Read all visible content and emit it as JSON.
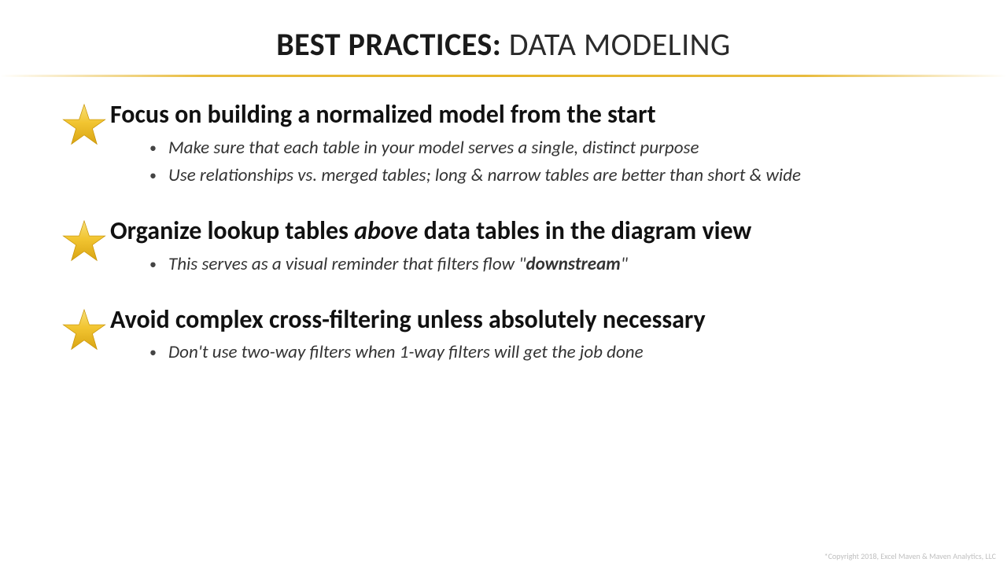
{
  "title": {
    "bold": "BEST PRACTICES:",
    "light": " DATA MODELING"
  },
  "items": [
    {
      "heading_parts": [
        {
          "text": "Focus on building a normalized model from the start",
          "em": false
        }
      ],
      "bullets": [
        {
          "parts": [
            {
              "text": "Make sure that each table in your model serves a single, distinct purpose",
              "b": false
            }
          ]
        },
        {
          "parts": [
            {
              "text": "Use relationships vs. merged tables; long & narrow tables are better than short & wide",
              "b": false
            }
          ]
        }
      ]
    },
    {
      "heading_parts": [
        {
          "text": "Organize lookup tables ",
          "em": false
        },
        {
          "text": "above",
          "em": true
        },
        {
          "text": " data tables in the diagram view",
          "em": false
        }
      ],
      "bullets": [
        {
          "parts": [
            {
              "text": "This serves as a visual reminder that filters flow \"",
              "b": false
            },
            {
              "text": "downstream",
              "b": true
            },
            {
              "text": "\"",
              "b": false
            }
          ]
        }
      ]
    },
    {
      "heading_parts": [
        {
          "text": "Avoid complex cross-filtering unless absolutely necessary",
          "em": false
        }
      ],
      "bullets": [
        {
          "parts": [
            {
              "text": "Don't use two-way filters when 1-way filters will get the job done",
              "b": false
            }
          ]
        }
      ]
    }
  ],
  "copyright": "*Copyright 2018, Excel Maven & Maven Analytics, LLC"
}
